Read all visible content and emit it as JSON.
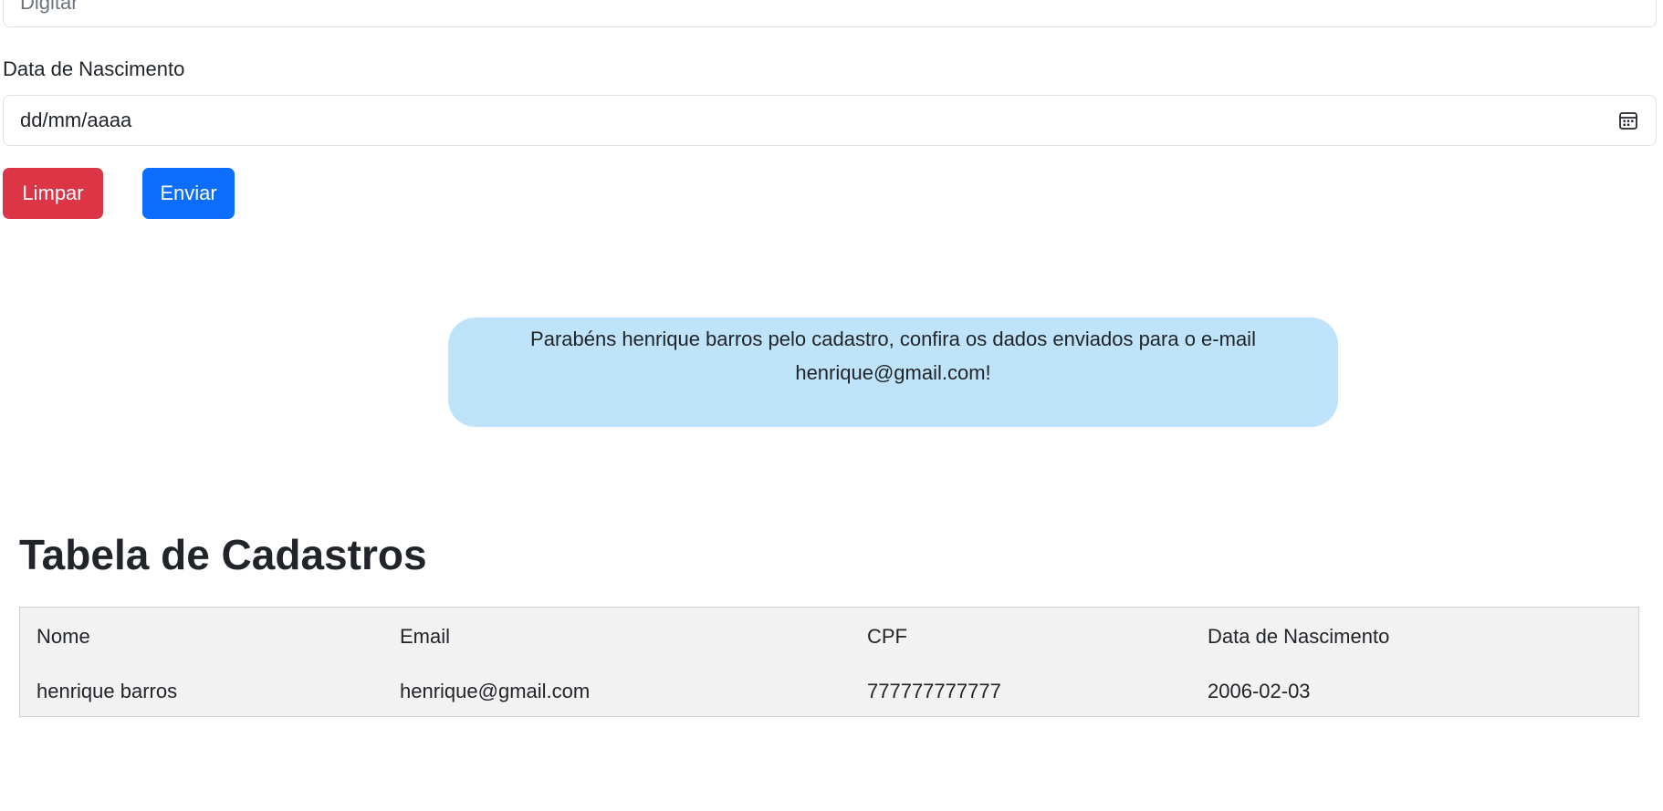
{
  "form": {
    "previous_field_placeholder": "Digitar",
    "birth_label": "Data de Nascimento",
    "birth_placeholder": "dd/mm/aaaa",
    "clear_label": "Limpar",
    "send_label": "Enviar"
  },
  "alert": {
    "line1": "Parabéns henrique barros pelo cadastro, confira os dados enviados para o e-mail",
    "line2": "henrique@gmail.com!"
  },
  "table": {
    "title": "Tabela de Cadastros",
    "columns": [
      "Nome",
      "Email",
      "CPF",
      "Data de Nascimento"
    ],
    "rows": [
      [
        "henrique barros",
        "henrique@gmail.com",
        "777777777777",
        "2006-02-03"
      ]
    ]
  },
  "colors": {
    "danger": "#dc3545",
    "primary": "#0d6efd",
    "alert_bg": "#bfe3f8",
    "table_bg": "#f2f2f2"
  }
}
